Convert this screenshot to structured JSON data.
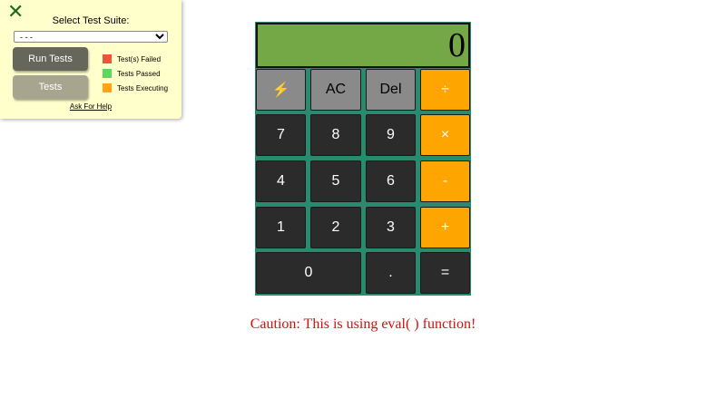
{
  "test_panel": {
    "close_glyph": "✕",
    "title": "Select Test Suite:",
    "select_value": "- - -",
    "run_button": "Run Tests",
    "tests_button": "Tests",
    "legend": [
      {
        "label": "Test(s) Failed",
        "color": "#f0533a"
      },
      {
        "label": "Tests Passed",
        "color": "#5fd65f"
      },
      {
        "label": "Tests Executing",
        "color": "#ffa21a"
      }
    ],
    "help_link": "Ask For Help"
  },
  "calculator": {
    "display": "0",
    "keys": {
      "flash": "⚡",
      "ac": "AC",
      "del": "Del",
      "divide": "÷",
      "seven": "7",
      "eight": "8",
      "nine": "9",
      "multiply": "×",
      "four": "4",
      "five": "5",
      "six": "6",
      "subtract": "-",
      "one": "1",
      "two": "2",
      "three": "3",
      "add": "+",
      "zero": "0",
      "decimal": ".",
      "equals": "="
    },
    "colors": {
      "frame": "#2a8a6e",
      "display": "#74a846",
      "gray_key": "#8a8a8a",
      "dark_key": "#2b2b2b",
      "orange_key": "#ffa500"
    }
  },
  "caution_text": "Caution: This is using eval( ) function!"
}
